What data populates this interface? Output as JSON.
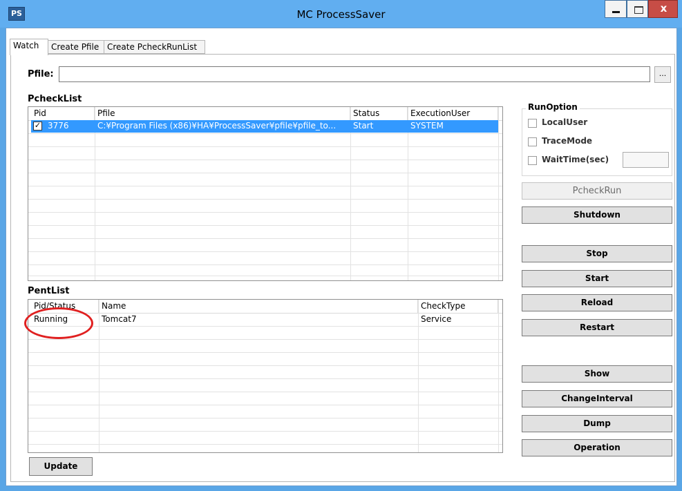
{
  "window": {
    "icon_text": "PS",
    "title": "MC ProcessSaver",
    "minimize_glyph": "",
    "close_glyph": "x"
  },
  "tabs": [
    {
      "label": "Watch",
      "active": true
    },
    {
      "label": "Create Pfile",
      "active": false
    },
    {
      "label": "Create PcheckRunList",
      "active": false
    }
  ],
  "pfile": {
    "label": "Pfile:",
    "value": "",
    "browse_label": "..."
  },
  "pcheck_list": {
    "label": "PcheckList",
    "columns": [
      "Pid",
      "Pfile",
      "Status",
      "ExecutionUser"
    ],
    "rows": [
      {
        "checked": true,
        "pid": "3776",
        "pfile": "C:¥Program Files (x86)¥HA¥ProcessSaver¥pfile¥pfile_to...",
        "status": "Start",
        "user": "SYSTEM",
        "selected": true
      }
    ]
  },
  "pent_list": {
    "label": "PentList",
    "columns": [
      "Pid/Status",
      "Name",
      "CheckType"
    ],
    "rows": [
      {
        "status": "Running",
        "name": "Tomcat7",
        "check_type": "Service"
      }
    ]
  },
  "run_option": {
    "legend": "RunOption",
    "local_user": {
      "label": "LocalUser",
      "checked": false
    },
    "trace_mode": {
      "label": "TraceMode",
      "checked": false
    },
    "wait_time": {
      "label": "WaitTime(sec)",
      "checked": false,
      "value": ""
    }
  },
  "buttons": {
    "pcheck_run": "PcheckRun",
    "shutdown": "Shutdown",
    "stop": "Stop",
    "start": "Start",
    "reload": "Reload",
    "restart": "Restart",
    "show": "Show",
    "change_interval": "ChangeInterval",
    "dump": "Dump",
    "operation": "Operation",
    "update": "Update"
  },
  "colors": {
    "titlebar": "#61aef0",
    "selection": "#3399ff",
    "annotation_circle": "#e02020",
    "close_button": "#c74d46"
  }
}
